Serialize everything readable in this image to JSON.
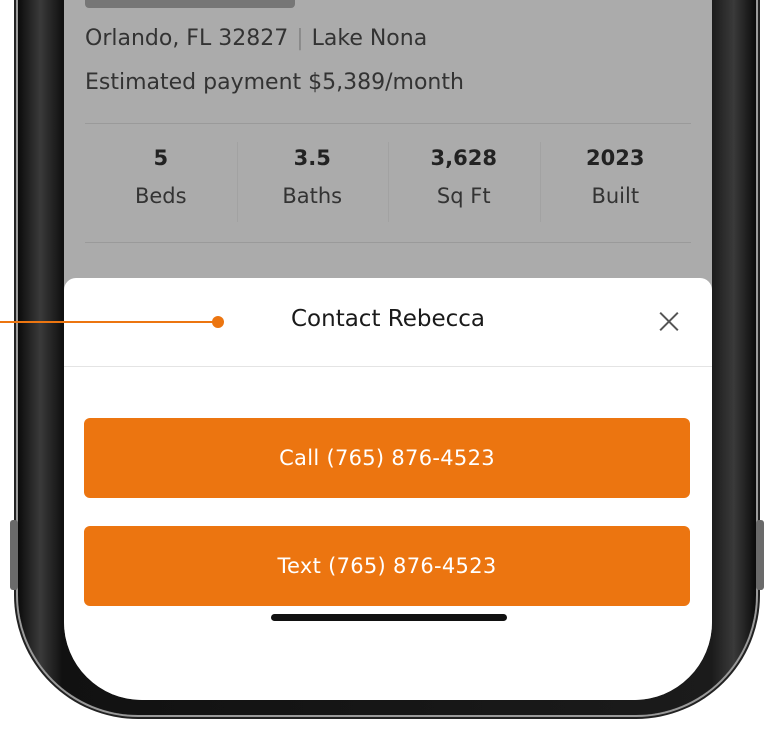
{
  "listing": {
    "location": "Orlando, FL 32827",
    "separator": "|",
    "neighborhood": "Lake Nona",
    "payment": "Estimated payment $5,389/month",
    "stats": [
      {
        "value": "5",
        "label": "Beds"
      },
      {
        "value": "3.5",
        "label": "Baths"
      },
      {
        "value": "3,628",
        "label": "Sq Ft"
      },
      {
        "value": "2023",
        "label": "Built"
      }
    ]
  },
  "modal": {
    "title": "Contact Rebecca",
    "close_icon": "close-icon",
    "call_label": "Call (765) 876-4523",
    "text_label": "Text (765) 876-4523"
  },
  "colors": {
    "accent": "#ec7510",
    "overlay": "#ababab",
    "sheet": "#ffffff"
  }
}
